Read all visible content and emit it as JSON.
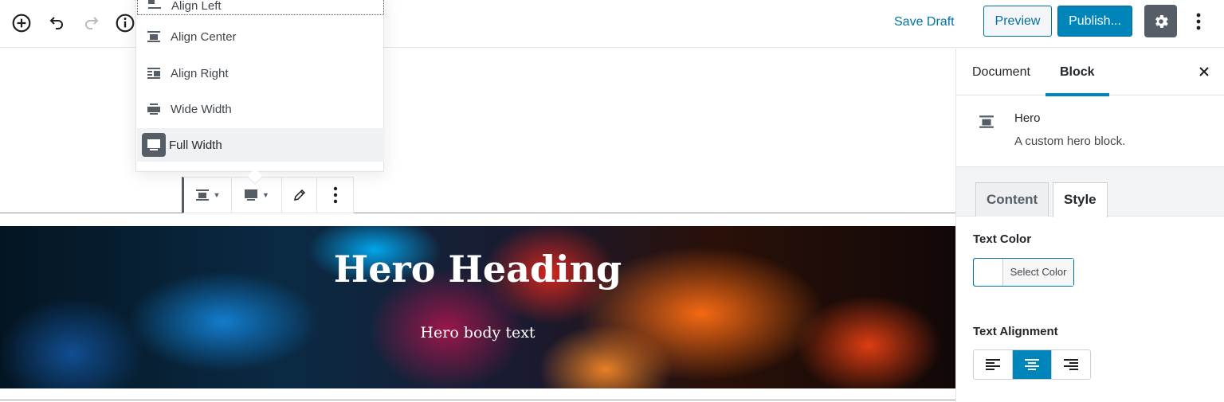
{
  "toolbar": {
    "add_block_icon": "plus-circle-icon",
    "undo_icon": "undo-icon",
    "redo_icon": "redo-icon",
    "info_icon": "info-icon",
    "save_draft_label": "Save Draft",
    "preview_label": "Preview",
    "publish_label": "Publish...",
    "settings_icon": "gear-icon",
    "more_icon": "vertical-ellipsis-icon"
  },
  "alignment_menu": {
    "items": [
      {
        "label": "Align Left",
        "icon": "align-left-icon"
      },
      {
        "label": "Align Center",
        "icon": "align-center-icon"
      },
      {
        "label": "Align Right",
        "icon": "align-right-icon"
      },
      {
        "label": "Wide Width",
        "icon": "align-wide-icon"
      },
      {
        "label": "Full Width",
        "icon": "align-full-width-icon"
      }
    ],
    "selected": "Full Width"
  },
  "block_toolbar": {
    "buttons": [
      "block-alignment",
      "full-width",
      "edit",
      "more-options"
    ]
  },
  "hero": {
    "heading": "Hero Heading",
    "body": "Hero body text"
  },
  "sidebar": {
    "tabs": [
      {
        "label": "Document"
      },
      {
        "label": "Block"
      }
    ],
    "active_tab": "Block",
    "block": {
      "title": "Hero",
      "description": "A custom hero block."
    },
    "inner_tabs": [
      {
        "label": "Content"
      },
      {
        "label": "Style"
      }
    ],
    "active_inner_tab": "Style",
    "text_color_label": "Text Color",
    "select_color_label": "Select Color",
    "text_alignment_label": "Text Alignment",
    "alignment_options": [
      "left",
      "center",
      "right"
    ],
    "selected_alignment": "center"
  },
  "colors": {
    "accent": "#0085ba",
    "link": "#0073aa",
    "dark_button": "#555d66"
  }
}
